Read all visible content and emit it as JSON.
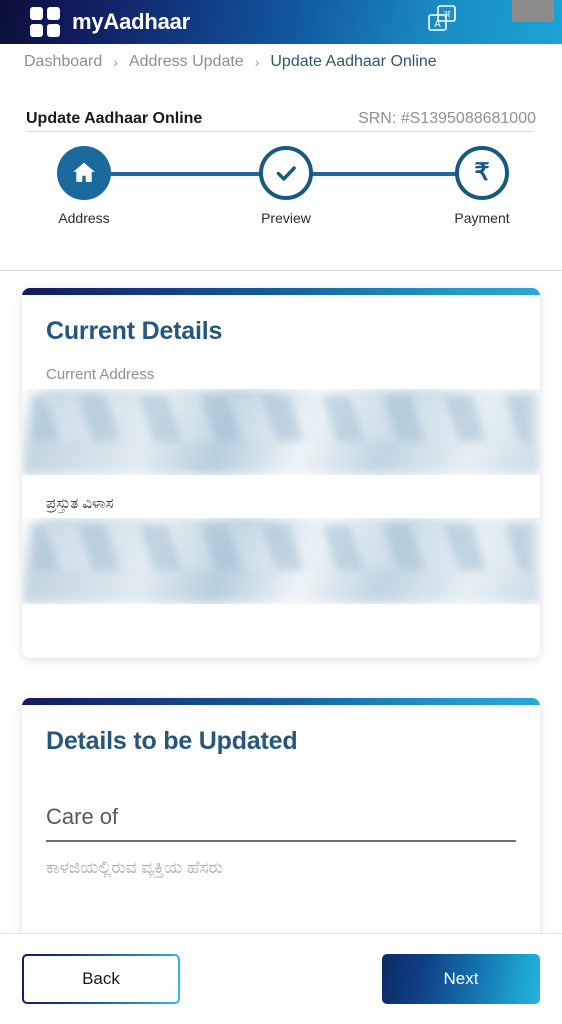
{
  "header": {
    "brand": "myAadhaar",
    "logo_icon": "grid-squares-logo",
    "language_icon": "language-translate-icon"
  },
  "breadcrumb": {
    "items": [
      {
        "label": "Dashboard",
        "active": false
      },
      {
        "label": "Address Update",
        "active": false
      },
      {
        "label": "Update Aadhaar Online",
        "active": true
      }
    ],
    "separator": "›"
  },
  "page": {
    "title": "Update Aadhaar Online",
    "srn": "SRN: #S1395088681000"
  },
  "stepper": {
    "steps": [
      {
        "label": "Address",
        "icon": "home-icon",
        "state": "active"
      },
      {
        "label": "Preview",
        "icon": "check-icon",
        "state": "upcoming"
      },
      {
        "label": "Payment",
        "icon": "rupee-icon",
        "state": "upcoming"
      }
    ]
  },
  "current_details": {
    "title": "Current Details",
    "address_label_en": "Current Address",
    "address_label_kn": "ಪ್ರಸ್ತುತ ವಿಳಾಸ"
  },
  "details_to_update": {
    "title": "Details to be Updated",
    "care_of_label": "Care of",
    "care_of_value": "",
    "care_of_hint_kn": "ಕಾಳಜಿಯಲ್ಲಿರುವ ವ್ಯಕ್ತಿಯ ಹೆಸರು"
  },
  "footer": {
    "back_label": "Back",
    "next_label": "Next"
  },
  "colors": {
    "header_gradient_start": "#0b1038",
    "header_gradient_end": "#1ba3d6",
    "accent_navy": "#141a5e",
    "accent_cyan": "#2ba8d8",
    "step_blue": "#1b6a9e",
    "card_title": "#27567c",
    "muted_text": "#8e9296"
  }
}
